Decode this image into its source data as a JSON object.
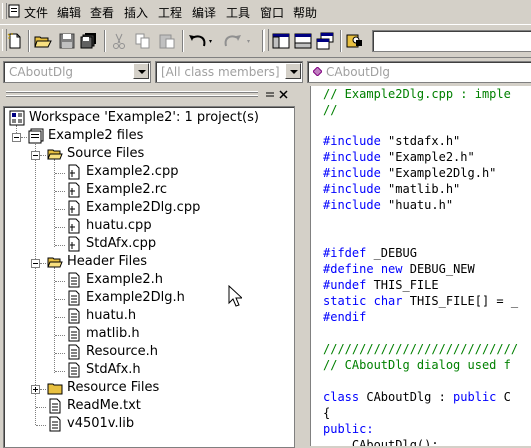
{
  "menu": [
    "文件",
    "编辑",
    "查看",
    "插入",
    "工程",
    "编译",
    "工具",
    "窗口",
    "帮助"
  ],
  "wizard": {
    "class_combo": "CAboutDlg",
    "members_combo": "[All class members]",
    "member_combo": "CAboutDlg"
  },
  "workspace": {
    "root": "Workspace 'Example2': 1 project(s)",
    "project": "Example2 files",
    "source_folder": "Source Files",
    "source_files": [
      "Example2.cpp",
      "Example2.rc",
      "Example2Dlg.cpp",
      "huatu.cpp",
      "StdAfx.cpp"
    ],
    "header_folder": "Header Files",
    "header_files": [
      "Example2.h",
      "Example2Dlg.h",
      "huatu.h",
      "matlib.h",
      "Resource.h",
      "StdAfx.h"
    ],
    "resource_folder": "Resource Files",
    "other_files": [
      "ReadMe.txt",
      "v4501v.lib"
    ]
  },
  "code": {
    "l1": "// Example2Dlg.cpp : imple",
    "l2": "//",
    "inc_kw": "#include",
    "includes": [
      "\"stdafx.h\"",
      "\"Example2.h\"",
      "\"Example2Dlg.h\"",
      "\"matlib.h\"",
      "\"huatu.h\""
    ],
    "ifdef_kw": "#ifdef",
    "ifdef_arg": " _DEBUG",
    "define_kw": "#define",
    "new_kw": "new",
    "debug_new": " DEBUG_NEW",
    "undef_kw": "#undef",
    "undef_arg": " THIS_FILE",
    "static_kw": "static",
    "char_kw": "char",
    "this_file_decl": " THIS_FILE[] = _",
    "endif_kw": "#endif",
    "slashes": "///////////////////////////",
    "comment2": "// CAboutDlg dialog used f",
    "class_kw": "class",
    "class_rest": " CAboutDlg : ",
    "public_kw": "public",
    "class_tail": " C",
    "brace": "{",
    "public_label": "public:",
    "ctor": "    CAboutDlg();"
  },
  "colors": {
    "keyword": "#0000ff",
    "comment": "#008000",
    "face": "#d4d0c8"
  }
}
